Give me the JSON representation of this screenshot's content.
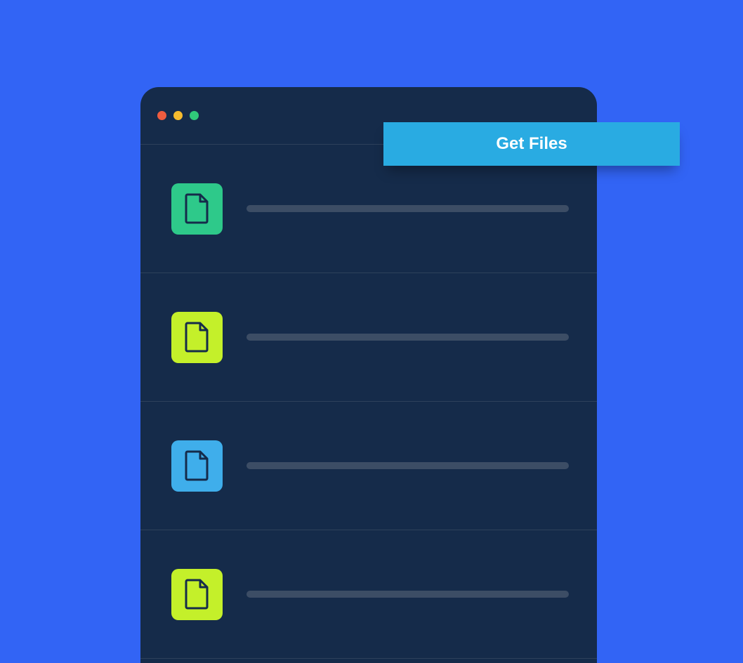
{
  "button": {
    "get_files_label": "Get Files"
  },
  "files": [
    {
      "chip_color": "#2EC98A"
    },
    {
      "chip_color": "#C4F02A"
    },
    {
      "chip_color": "#3FAEEB"
    },
    {
      "chip_color": "#C4F02A"
    }
  ],
  "icons": {
    "file_stroke": "#152B4A"
  }
}
